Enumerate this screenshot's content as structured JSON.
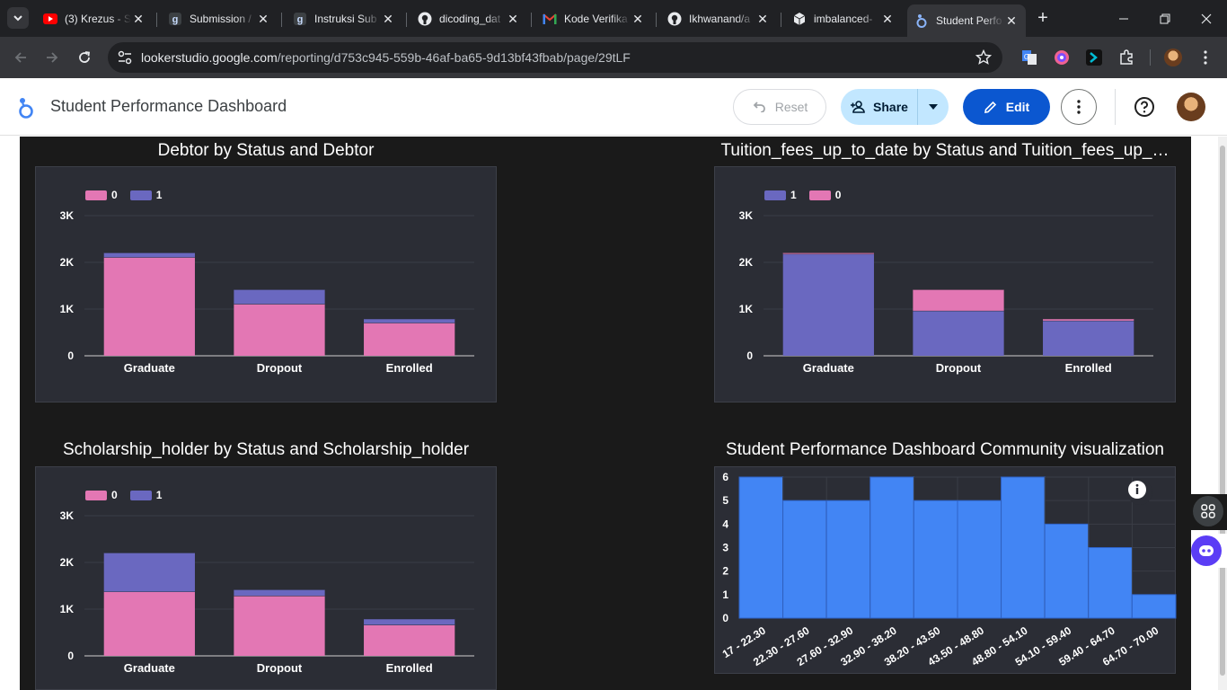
{
  "browser": {
    "tabs": [
      {
        "title": "(3) Krezus - S",
        "icon": "youtube-icon"
      },
      {
        "title": "Submission /",
        "icon": "dicoding-icon"
      },
      {
        "title": "Instruksi Sub",
        "icon": "dicoding-icon"
      },
      {
        "title": "dicoding_dat",
        "icon": "github-icon"
      },
      {
        "title": "Kode Verifika",
        "icon": "gmail-icon"
      },
      {
        "title": "Ikhwanand/a",
        "icon": "github-icon"
      },
      {
        "title": "imbalanced-",
        "icon": "cube-icon"
      },
      {
        "title": "Student Perfo",
        "icon": "looker-studio-icon",
        "active": true
      }
    ],
    "url_host": "lookerstudio.google.com",
    "url_path": "/reporting/d753c945-559b-46af-ba65-9d13bf43fbab/page/29tLF"
  },
  "app": {
    "title": "Student Performance Dashboard",
    "reset_label": "Reset",
    "share_label": "Share",
    "edit_label": "Edit"
  },
  "colors": {
    "pink": "#e377b4",
    "purple": "#6a68c0",
    "blue": "#4285f4",
    "panel": "#2b2d35",
    "report_bg": "#1a1a1a"
  },
  "chart_data": [
    {
      "title": "Debtor by Status and Debtor",
      "type": "bar",
      "stacked": true,
      "categories": [
        "Graduate",
        "Dropout",
        "Enrolled"
      ],
      "series": [
        {
          "name": "0",
          "color": "#e377b4",
          "values": [
            2108,
            1109,
            704
          ]
        },
        {
          "name": "1",
          "color": "#6a68c0",
          "values": [
            101,
            312,
            90
          ]
        }
      ],
      "legend": [
        "0",
        "1"
      ],
      "yticks": [
        "0",
        "1K",
        "2K",
        "3K"
      ],
      "ylim": [
        0,
        3000
      ]
    },
    {
      "title": "Tuition_fees_up_to_date by Status and Tuition_fees_up_…",
      "type": "bar",
      "stacked": true,
      "categories": [
        "Graduate",
        "Dropout",
        "Enrolled"
      ],
      "series": [
        {
          "name": "1",
          "color": "#6a68c0",
          "values": [
            2180,
            964,
            752
          ]
        },
        {
          "name": "0",
          "color": "#e377b4",
          "values": [
            29,
            457,
            42
          ]
        }
      ],
      "legend": [
        "1",
        "0"
      ],
      "yticks": [
        "0",
        "1K",
        "2K",
        "3K"
      ],
      "ylim": [
        0,
        3000
      ]
    },
    {
      "title": "Scholarship_holder by Status and Scholarship_holder",
      "type": "bar",
      "stacked": true,
      "categories": [
        "Graduate",
        "Dropout",
        "Enrolled"
      ],
      "series": [
        {
          "name": "0",
          "color": "#e377b4",
          "values": [
            1374,
            1287,
            664
          ]
        },
        {
          "name": "1",
          "color": "#6a68c0",
          "values": [
            835,
            134,
            130
          ]
        }
      ],
      "legend": [
        "0",
        "1"
      ],
      "yticks": [
        "0",
        "1K",
        "2K",
        "3K"
      ],
      "ylim": [
        0,
        3000
      ]
    },
    {
      "title": "Student Performance Dashboard Community visualization",
      "type": "bar",
      "histogram": true,
      "color": "#4285f4",
      "categories": [
        "17 - 22.30",
        "22.30 - 27.60",
        "27.60 - 32.90",
        "32.90 - 38.20",
        "38.20 - 43.50",
        "43.50 - 48.80",
        "48.80 - 54.10",
        "54.10 - 59.40",
        "59.40 - 64.70",
        "64.70 - 70.00"
      ],
      "values": [
        6,
        5,
        5,
        6,
        5,
        5,
        6,
        4,
        3,
        1
      ],
      "yticks": [
        "0",
        "1",
        "2",
        "3",
        "4",
        "5",
        "6"
      ],
      "ylim": [
        0,
        6
      ]
    }
  ]
}
